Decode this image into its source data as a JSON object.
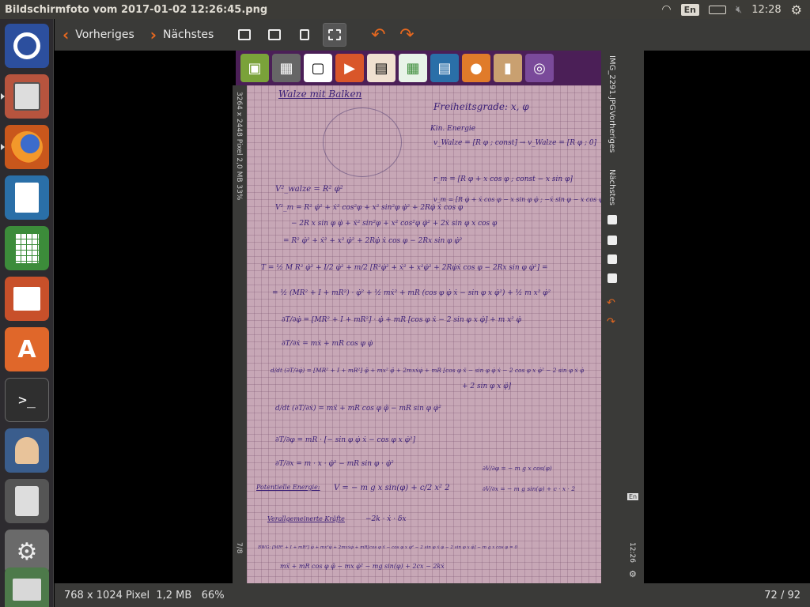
{
  "topbar": {
    "title": "Bildschirmfoto vom 2017-01-02 12:26:45.png",
    "lang": "En",
    "time": "12:28"
  },
  "launcher": {
    "items": [
      "ubuntu-dash",
      "files",
      "firefox",
      "writer",
      "calc",
      "impress",
      "software-center",
      "terminal",
      "user-settings",
      "calculator",
      "system-settings",
      "image-viewer"
    ]
  },
  "toolbar": {
    "prev_label": "Vorheriges",
    "next_label": "Nächstes"
  },
  "bottombar": {
    "info": "768 x 1024 Pixel  1,2 MB   66%",
    "page": "72 / 92"
  },
  "inner": {
    "side_info": "3264 x 2448 Pixel  2,0 MB   33%",
    "side_page": "7/8",
    "file_name": "IMG_2291.JPG",
    "prev_label": "Vorheriges",
    "next_label": "Nächstes",
    "lang": "En",
    "time": "12:26"
  },
  "notes": {
    "heading": "Walze mit Balken",
    "dof": "Freiheitsgrade: x, φ",
    "kin": "Kin. Energie",
    "v_walze": "v_Walze = [R φ ; const]  →  v_Walze = [R φ ; 0]",
    "r_m": "r_m = [R φ + x cos φ ; const − x sin φ]",
    "v_m": "v_m = [R φ̇ + ẋ cos φ − x sin φ φ̇ ; −ẋ sin φ − x cos φ φ̇]",
    "l1": "V²_walze = R² φ̇²",
    "l2": "V²_m = R² φ̇² + ẋ² cos²φ + x² sin²φ φ̇² + 2Rφ̇ ẋ cos φ",
    "l3": "− 2R x sin φ φ̇ + ẋ² sin²φ + x² cos²φ φ̇² + 2ẋ sin φ x cos φ",
    "l4": "= R² φ̇² + ẋ² + x² φ̇² + 2Rφ̇ ẋ cos φ − 2Rx sin φ φ̇²",
    "t1": "T = ½ M R² φ̇² + I/2 φ̇² + m/2 [R²φ̇² + ẋ² + x²φ̇² + 2Rφ̇ẋ cos φ − 2Rx sin φ φ̇²] =",
    "t2": "= ½ (MR² + I + mR²) · φ̇² + ½ mẋ² + mR (cos φ φ̇ ẋ − sin φ x φ̇²) + ½ m x² φ̇²",
    "d1": "∂T/∂φ̇ = [MR² + I + mR²] · φ̇ + mR [cos φ ẋ − 2 sin φ x φ̇] + m x² φ̇",
    "d2": "∂T/∂ẋ = mẋ + mR cos φ φ̇",
    "d3": "d/dt (∂T/∂φ̇) = [MR² + I + mR²] φ̈ + mx² φ̈ + 2mxẋφ̇ + mR [cos φ ẍ − sin φ φ̇ ẋ − 2 cos φ x φ̇² − 2 sin φ ẋ φ̇",
    "d3b": "+ 2 sin φ x φ̈]",
    "d4": "d/dt (∂T/∂ẋ) = mẍ + mR cos φ φ̈ − mR sin φ φ̇²",
    "d5": "∂T/∂φ = mR · [− sin φ φ̇ ẋ − cos φ x φ̇²]",
    "d6": "∂T/∂x = m · x · φ̇² − mR sin φ · φ̇²",
    "pot_label": "Potentielle Energie:",
    "pot": "V = − m g x sin(φ) + c/2 x²  2",
    "dv1": "∂V/∂φ = − m g x cos(φ)",
    "dv2": "∂V/∂x = − m g sin(φ) + c · x · 2",
    "nc_label": "Verallgemeinerte Kräfte",
    "nc": "−2k · ẋ · δx",
    "bwg": "BWG: [MR² + I + mR²] φ̈ + mx²φ̈ + 2mxẋφ̇ + mR[cos φ ẍ − cos φ x φ̇² − 2 sin φ ẋ φ̇ − 2 sin φ x φ̈] − m g x cos φ = 0",
    "bwg2": "mẍ + mR cos φ φ̈ − mx φ̇² − mg sin(φ) + 2cx − 2kẋ"
  }
}
